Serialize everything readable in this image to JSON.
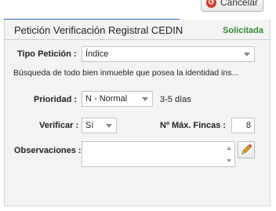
{
  "top_bar": {
    "cancel_label": "Cancelar",
    "cancel_icon": "cancel-circle-icon"
  },
  "panel": {
    "title": "Petición Verificación Registral CEDIN",
    "status": "Solicitada",
    "status_color": "#2e8b2e",
    "accent_color": "#2f6fba"
  },
  "form": {
    "tipo_peticion": {
      "label": "Tipo Petición :",
      "value": "Índice",
      "description": "Búsqueda de todo bien inmueble que posea la identidad ins..."
    },
    "prioridad": {
      "label": "Prioridad :",
      "value": "N - Normal",
      "note": "3-5 días"
    },
    "verificar": {
      "label": "Verificar :",
      "value": "Sí"
    },
    "max_fincas": {
      "label": "Nº Máx. Fincas :",
      "value": "8"
    },
    "observaciones": {
      "label": "Observaciones :",
      "value": "",
      "edit_icon": "pencil-icon"
    }
  }
}
